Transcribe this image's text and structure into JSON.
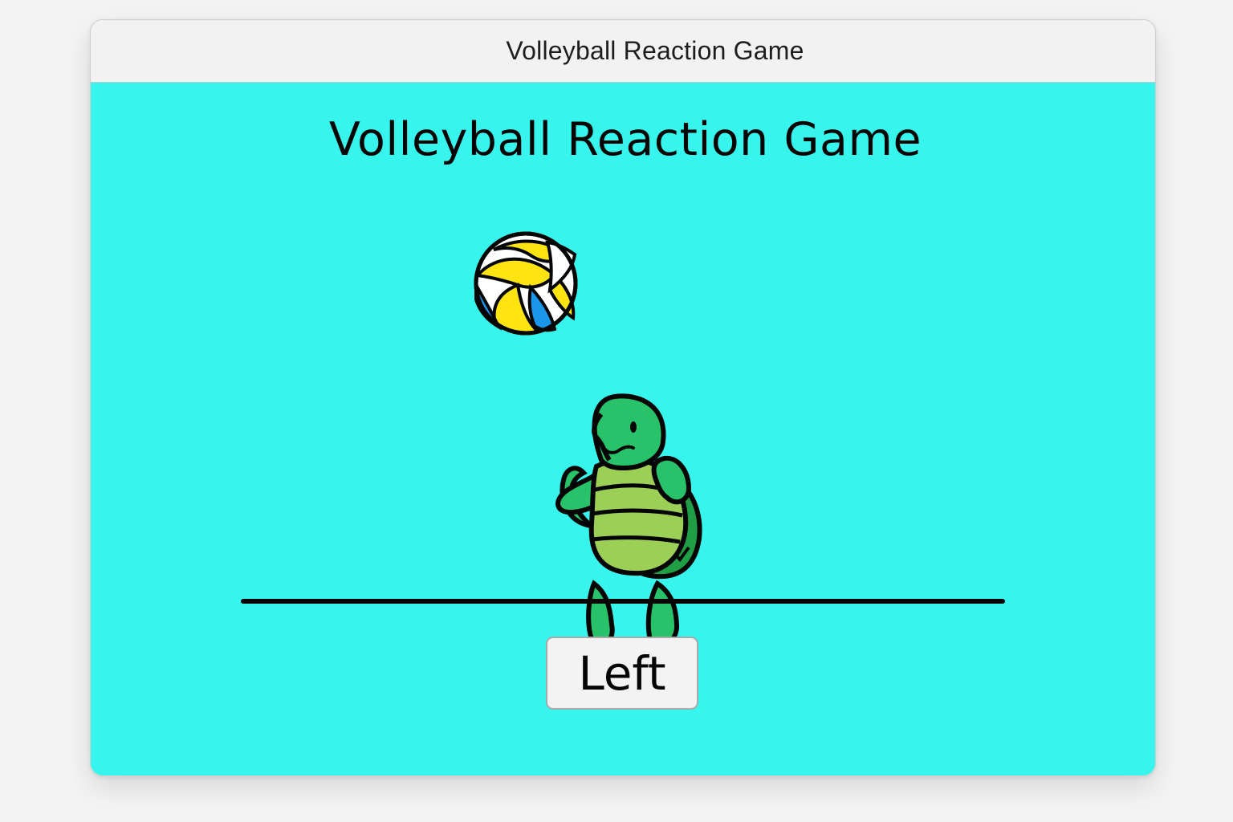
{
  "window": {
    "title": "Volleyball Reaction Game"
  },
  "game": {
    "heading": "Volleyball Reaction Game",
    "background_color": "#37f5ec",
    "ball_icon": "volleyball-icon",
    "player_icon": "turtle-character-icon"
  },
  "controls": {
    "left_label": "Left"
  }
}
